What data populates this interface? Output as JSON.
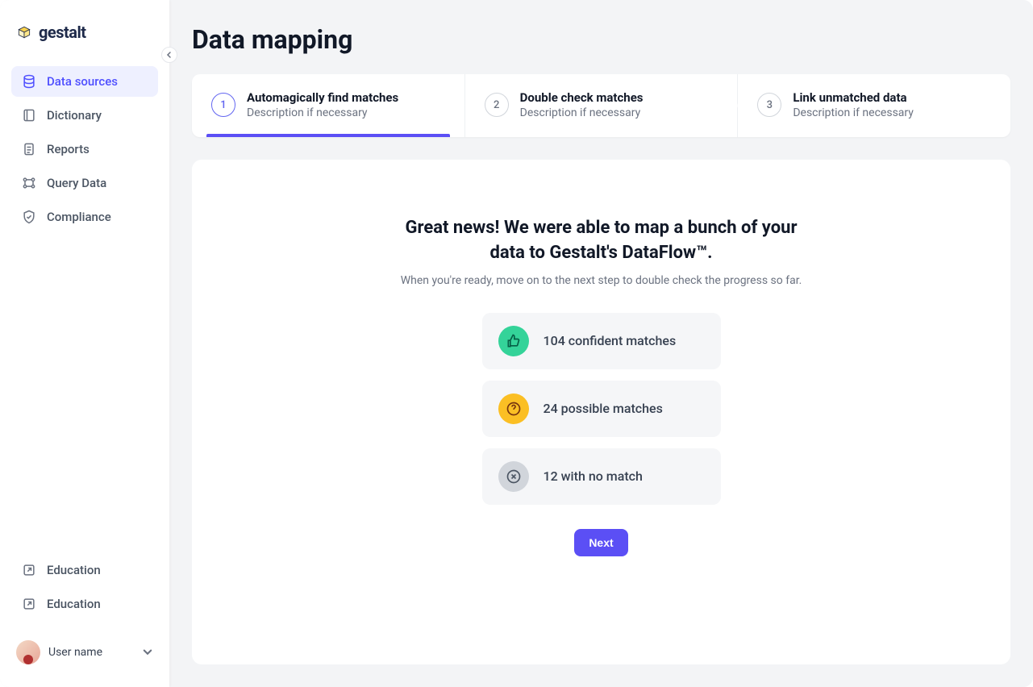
{
  "brand": {
    "name": "gestalt"
  },
  "sidebar": {
    "items": [
      {
        "label": "Data sources"
      },
      {
        "label": "Dictionary"
      },
      {
        "label": "Reports"
      },
      {
        "label": "Query Data"
      },
      {
        "label": "Compliance"
      }
    ],
    "footer_items": [
      {
        "label": "Education"
      },
      {
        "label": "Education"
      }
    ],
    "user": {
      "name": "User name"
    }
  },
  "page": {
    "title": "Data mapping"
  },
  "stepper": {
    "steps": [
      {
        "num": "1",
        "title": "Automagically find matches",
        "desc": "Description if necessary"
      },
      {
        "num": "2",
        "title": "Double check matches",
        "desc": "Description if necessary"
      },
      {
        "num": "3",
        "title": "Link unmatched data",
        "desc": "Description if necessary"
      }
    ]
  },
  "content": {
    "headline": "Great news! We were able to map a bunch of your data to Gestalt's DataFlow™.",
    "subline": "When you're ready, move on to the next step to double check the progress so far.",
    "stats": [
      {
        "text": "104 confident matches"
      },
      {
        "text": "24 possible matches"
      },
      {
        "text": "12 with no match"
      }
    ],
    "next_label": "Next"
  }
}
